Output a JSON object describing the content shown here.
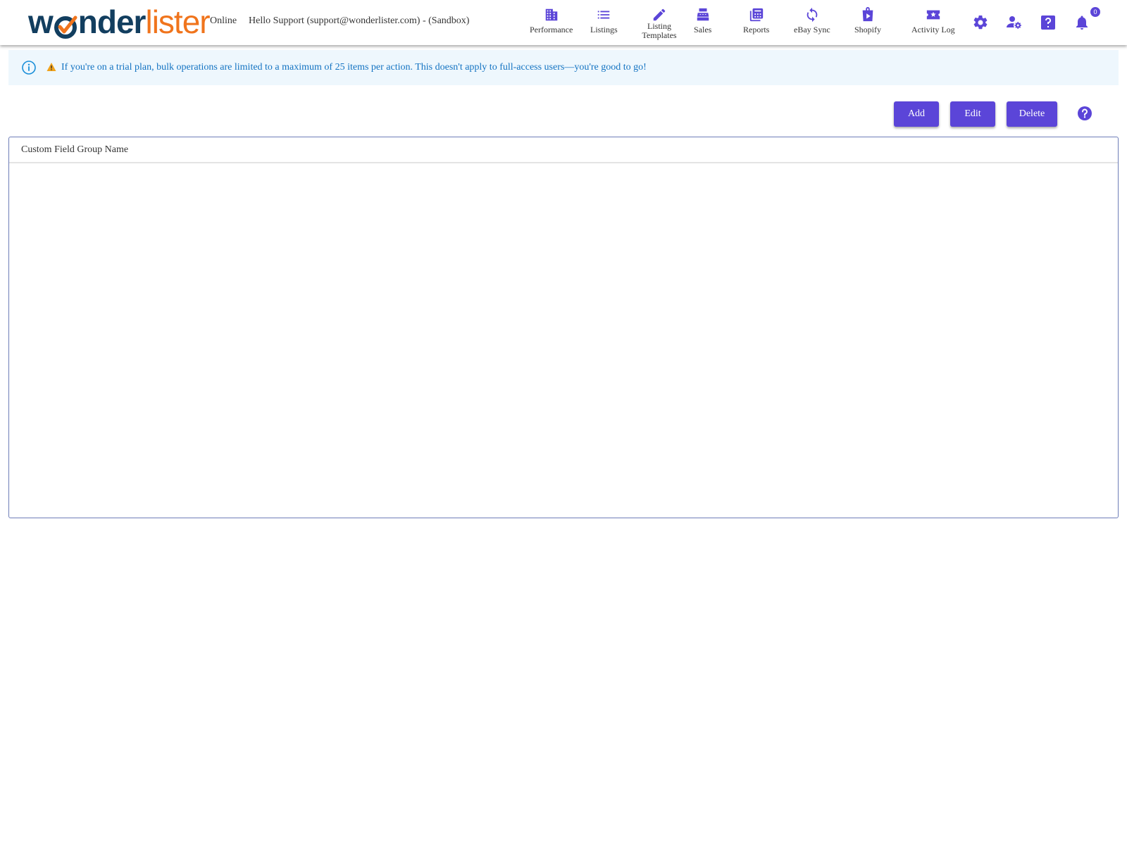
{
  "header": {
    "logo_text_1": "w",
    "logo_text_2": "nder",
    "logo_text_3": "lister",
    "status": "Online",
    "greeting": "Hello Support (support@wonderlister.com) - (Sandbox)",
    "nav": [
      {
        "label": "Performance",
        "icon": "building-icon"
      },
      {
        "label": "Listings",
        "icon": "list-icon"
      },
      {
        "label": "Listing Templates",
        "icon": "pencil-icon"
      },
      {
        "label": "Sales",
        "icon": "cash-register-icon"
      },
      {
        "label": "Reports",
        "icon": "reports-icon"
      },
      {
        "label": "eBay Sync",
        "icon": "sync-icon"
      },
      {
        "label": "Shopify",
        "icon": "shopify-bag-icon"
      },
      {
        "label": "Activity Log",
        "icon": "ticket-star-icon"
      }
    ],
    "notification_count": "0"
  },
  "banner": {
    "text": "If you're on a trial plan, bulk operations are limited to a maximum of 25 items per action. This doesn't apply to full-access users—you're good to go!"
  },
  "toolbar": {
    "add_label": "Add",
    "edit_label": "Edit",
    "delete_label": "Delete"
  },
  "grid": {
    "columns": [
      "Custom Field Group Name"
    ],
    "rows": []
  },
  "colors": {
    "accent": "#5b45d8",
    "logo_dark": "#123e5f",
    "logo_orange": "#f0741c",
    "banner_bg": "#eef7fd",
    "banner_text": "#1373c2"
  }
}
